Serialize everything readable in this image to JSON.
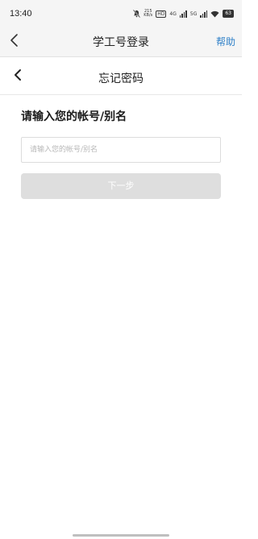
{
  "status_bar": {
    "time": "13:40",
    "net_speed_value": "215",
    "net_speed_unit": "KB/s",
    "hd_label": "HD",
    "network_1": "4G",
    "network_2": "5G",
    "battery": "63",
    "icons": [
      "bell-off-icon",
      "signal-icon",
      "wifi-icon",
      "battery-icon"
    ]
  },
  "header": {
    "title": "学工号登录",
    "help": "帮助",
    "back_icon": "chevron-left-icon"
  },
  "subheader": {
    "title": "忘记密码",
    "back_icon": "chevron-left-icon"
  },
  "form": {
    "heading": "请输入您的帐号/别名",
    "account_placeholder": "请输入您的帐号/别名",
    "account_value": "",
    "next_label": "下一步"
  },
  "colors": {
    "accent": "#2f80c8",
    "disabled_button": "#dedede",
    "header_bg": "#f5f5f5"
  }
}
